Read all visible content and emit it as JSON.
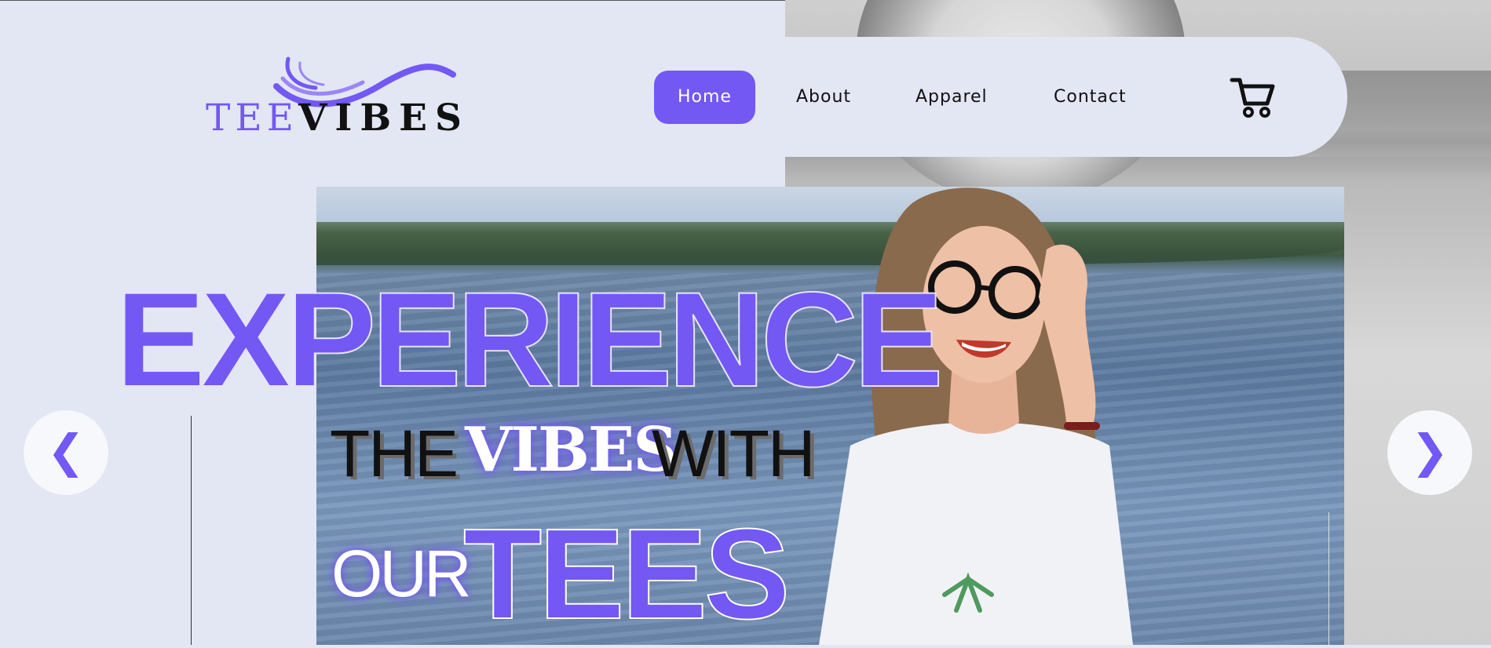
{
  "brand": {
    "logo_part1": "TEE",
    "logo_part2": "VIBES",
    "accent_color": "#7358f4"
  },
  "nav": {
    "items": [
      {
        "label": "Home",
        "active": true
      },
      {
        "label": "About",
        "active": false
      },
      {
        "label": "Apparel",
        "active": false
      },
      {
        "label": "Contact",
        "active": false
      }
    ],
    "cart_icon": "cart-icon"
  },
  "hero": {
    "headline_line1": "EXPERIENCE",
    "headline_the": "THE",
    "headline_vibes": "VIBES",
    "headline_with": "WITH",
    "headline_our": "OUR",
    "headline_tees": "TEES",
    "prev_icon": "chevron-left-icon",
    "next_icon": "chevron-right-icon",
    "prev_glyph": "❮",
    "next_glyph": "❯"
  }
}
